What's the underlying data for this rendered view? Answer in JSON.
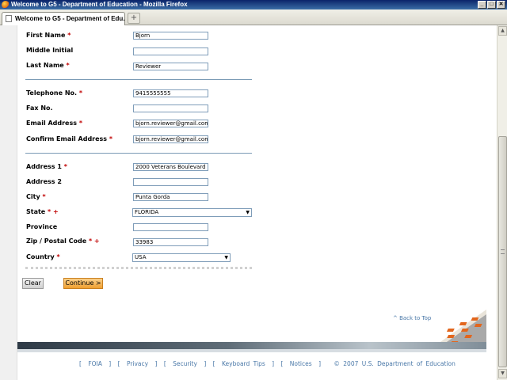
{
  "window": {
    "title": "Welcome to G5 - Department of Education - Mozilla Firefox",
    "tab_label": "Welcome to G5 - Department of Edu...",
    "new_tab_label": "+",
    "minimize": "_",
    "maximize": "□",
    "close": "✕"
  },
  "form": {
    "first_name": {
      "label": "First Name",
      "required": "*",
      "value": "Bjorn"
    },
    "middle_initial": {
      "label": "Middle Initial",
      "value": ""
    },
    "last_name": {
      "label": "Last Name",
      "required": "*",
      "value": "Reviewer"
    },
    "telephone": {
      "label": "Telephone No.",
      "required": "*",
      "value": "9415555555"
    },
    "fax": {
      "label": "Fax No.",
      "value": ""
    },
    "email": {
      "label": "Email Address",
      "required": "*",
      "value": "bjorn.reviewer@gmail.com"
    },
    "confirm_email": {
      "label": "Confirm Email Address",
      "required": "*",
      "value": "bjorn.reviewer@gmail.com"
    },
    "address1": {
      "label": "Address 1",
      "required": "*",
      "value": "2000 Veterans Boulevard"
    },
    "address2": {
      "label": "Address 2",
      "value": ""
    },
    "city": {
      "label": "City",
      "required": "*",
      "value": "Punta Gorda"
    },
    "state": {
      "label": "State",
      "required": "* +",
      "value": "FLORIDA"
    },
    "province": {
      "label": "Province",
      "value": ""
    },
    "zip": {
      "label": "Zip / Postal Code",
      "required": "* +",
      "value": "33983"
    },
    "country": {
      "label": "Country",
      "required": "*",
      "value": "USA"
    }
  },
  "buttons": {
    "clear": "Clear",
    "continue": "Continue >"
  },
  "back_to_top": "^ Back to Top",
  "footer": {
    "links": [
      "FOIA",
      "Privacy",
      "Security",
      "Keyboard Tips",
      "Notices"
    ],
    "copyright": "© 2007 U.S. Department of Education"
  },
  "colors": {
    "required": "#c00000",
    "link": "#4a78a8",
    "continue_button": "#f0a030"
  }
}
